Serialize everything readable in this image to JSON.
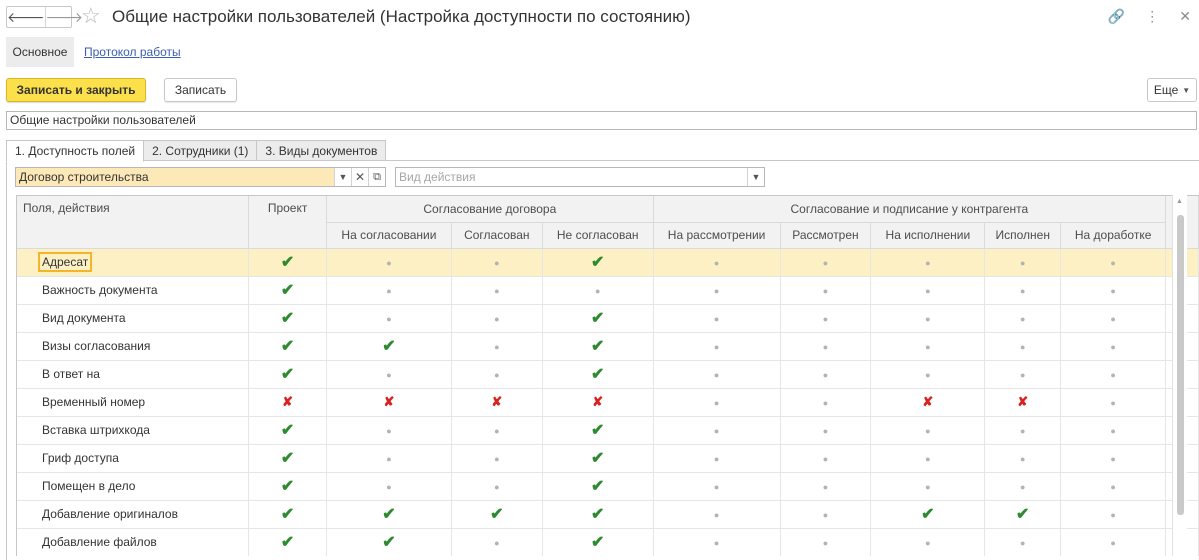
{
  "window": {
    "title": "Общие настройки пользователей (Настройка доступности по состоянию)"
  },
  "section_tabs": {
    "main": "Основное",
    "log": "Протокол работы"
  },
  "toolbar": {
    "save_close": "Записать и закрыть",
    "save": "Записать",
    "more": "Еще"
  },
  "name_value": "Общие настройки пользователей",
  "tabs": [
    "1. Доступность полей",
    "2. Сотрудники (1)",
    "3. Виды документов"
  ],
  "filters": {
    "contract_type": "Договор строительства",
    "action_placeholder": "Вид действия"
  },
  "grid": {
    "first_header": "Поля, действия",
    "project_header": "Проект",
    "group1": "Согласование договора",
    "group2": "Согласование и подписание у контрагента",
    "columns": [
      "На согласовании",
      "Согласован",
      "Не согласован",
      "На рассмотрении",
      "Рассмотрен",
      "На исполнении",
      "Исполнен",
      "На доработке"
    ],
    "rows": [
      {
        "name": "Адресат",
        "selected": true,
        "values": [
          "yes",
          "na",
          "na",
          "yes",
          "na",
          "na",
          "na",
          "na",
          "na"
        ]
      },
      {
        "name": "Важность документа",
        "values": [
          "yes",
          "na",
          "na",
          "na",
          "na",
          "na",
          "na",
          "na",
          "na"
        ]
      },
      {
        "name": "Вид документа",
        "values": [
          "yes",
          "na",
          "na",
          "yes",
          "na",
          "na",
          "na",
          "na",
          "na"
        ]
      },
      {
        "name": "Визы согласования",
        "values": [
          "yes",
          "yes",
          "na",
          "yes",
          "na",
          "na",
          "na",
          "na",
          "na"
        ]
      },
      {
        "name": "В ответ на",
        "values": [
          "yes",
          "na",
          "na",
          "yes",
          "na",
          "na",
          "na",
          "na",
          "na"
        ]
      },
      {
        "name": "Временный номер",
        "values": [
          "no",
          "no",
          "no",
          "no",
          "na",
          "na",
          "no",
          "no",
          "na"
        ]
      },
      {
        "name": "Вставка штрихкода",
        "values": [
          "yes",
          "na",
          "na",
          "yes",
          "na",
          "na",
          "na",
          "na",
          "na"
        ]
      },
      {
        "name": "Гриф доступа",
        "values": [
          "yes",
          "na",
          "na",
          "yes",
          "na",
          "na",
          "na",
          "na",
          "na"
        ]
      },
      {
        "name": "Помещен в дело",
        "values": [
          "yes",
          "na",
          "na",
          "yes",
          "na",
          "na",
          "na",
          "na",
          "na"
        ]
      },
      {
        "name": "Добавление оригиналов",
        "values": [
          "yes",
          "yes",
          "yes",
          "yes",
          "na",
          "na",
          "yes",
          "yes",
          "na"
        ]
      },
      {
        "name": "Добавление файлов",
        "values": [
          "yes",
          "yes",
          "na",
          "yes",
          "na",
          "na",
          "na",
          "na",
          "na"
        ]
      }
    ]
  }
}
